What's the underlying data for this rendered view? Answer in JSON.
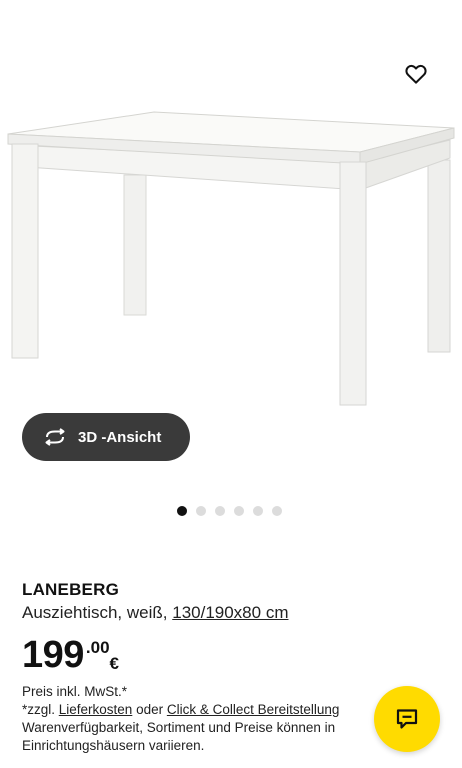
{
  "product": {
    "name": "LANEBERG",
    "description": "Ausziehtisch, weiß, ",
    "dimensions_link": "130/190x80 cm",
    "price_integer": "199",
    "price_decimal": ".00",
    "currency": "€"
  },
  "gallery": {
    "view_3d_label": "3D -Ansicht",
    "image_count": 6,
    "active_index": 0
  },
  "info": {
    "line1": "Preis inkl. MwSt.*",
    "line2_prefix": "*zzgl. ",
    "line2_link1": "Lieferkosten",
    "line2_middle": " oder ",
    "line2_link2": "Click & Collect Bereitstellung",
    "line3": "Warenverfügbarkeit, Sortiment und Preise können in",
    "line4": "Einrichtungshäusern variieren."
  },
  "icons": {
    "favorite": "heart-icon",
    "rotate": "rotate-3d-icon",
    "chat": "chat-icon"
  },
  "colors": {
    "chat_button": "#ffdb00",
    "pill_button": "#3a3a3a",
    "active_dot": "#111111",
    "inactive_dot": "#dcdcdc"
  }
}
